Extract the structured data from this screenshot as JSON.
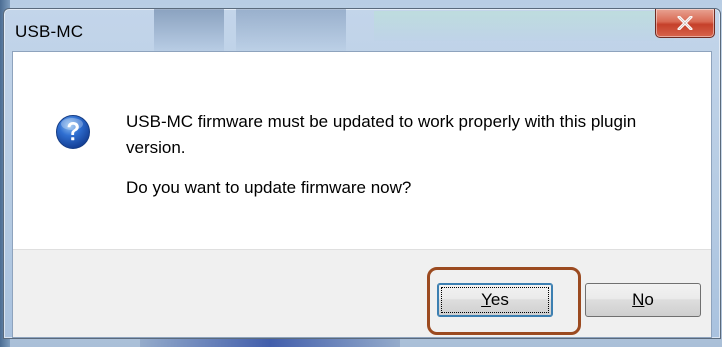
{
  "window": {
    "title": "USB-MC",
    "close_icon": "close-x-icon"
  },
  "dialog": {
    "icon": "question-icon",
    "message_line1": "USB-MC firmware must be updated to work properly with this plugin version.",
    "message_line2": "Do you want to update firmware now?"
  },
  "buttons": {
    "yes": {
      "mnemonic": "Y",
      "rest": "es"
    },
    "no": {
      "mnemonic": "N",
      "rest": "o"
    }
  },
  "colors": {
    "highlight_border": "#9b4a20",
    "close_button": "#c5402a",
    "default_button_border": "#3c7fb1"
  }
}
